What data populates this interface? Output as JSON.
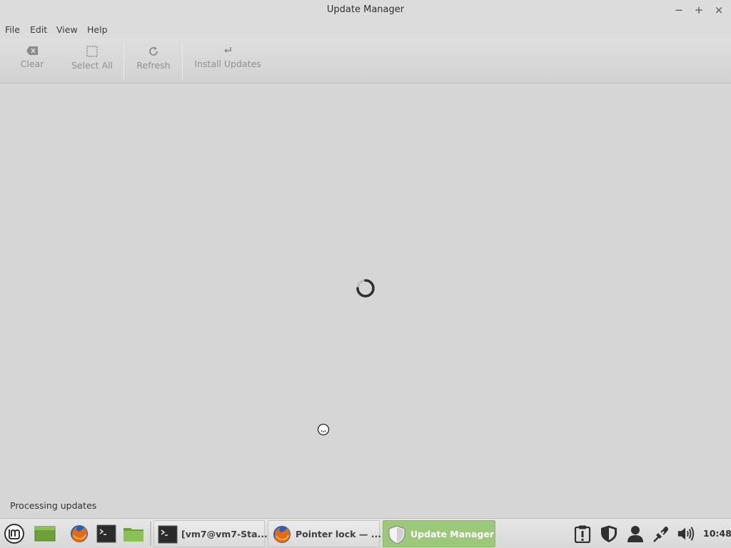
{
  "window": {
    "title": "Update Manager",
    "controls": {
      "minimize": "−",
      "maximize": "+",
      "close": "×"
    }
  },
  "menu": {
    "items": [
      {
        "label": "File"
      },
      {
        "label": "Edit"
      },
      {
        "label": "View"
      },
      {
        "label": "Help"
      }
    ]
  },
  "toolbar": {
    "clear": {
      "label": "Clear",
      "icon": "clear-icon",
      "enabled": false
    },
    "select_all": {
      "label": "Select All",
      "icon": "select-all-icon",
      "enabled": false
    },
    "refresh": {
      "label": "Refresh",
      "icon": "refresh-icon",
      "enabled": false
    },
    "install_updates": {
      "label": "Install Updates",
      "icon": "install-icon",
      "enabled": false
    }
  },
  "content": {
    "loading": true
  },
  "statusbar": {
    "text": "Processing updates"
  },
  "taskbar": {
    "windows": [
      {
        "label": "[vm7@vm7-Sta...",
        "icon": "terminal-icon",
        "active": false
      },
      {
        "label": "Pointer lock — ...",
        "icon": "firefox-icon",
        "active": false
      },
      {
        "label": "Update Manager",
        "icon": "shield-icon",
        "active": true
      }
    ],
    "clock": "10:48"
  },
  "colors": {
    "active_window_tab": "#9cc87a",
    "mint_green": "#7fb34a"
  }
}
